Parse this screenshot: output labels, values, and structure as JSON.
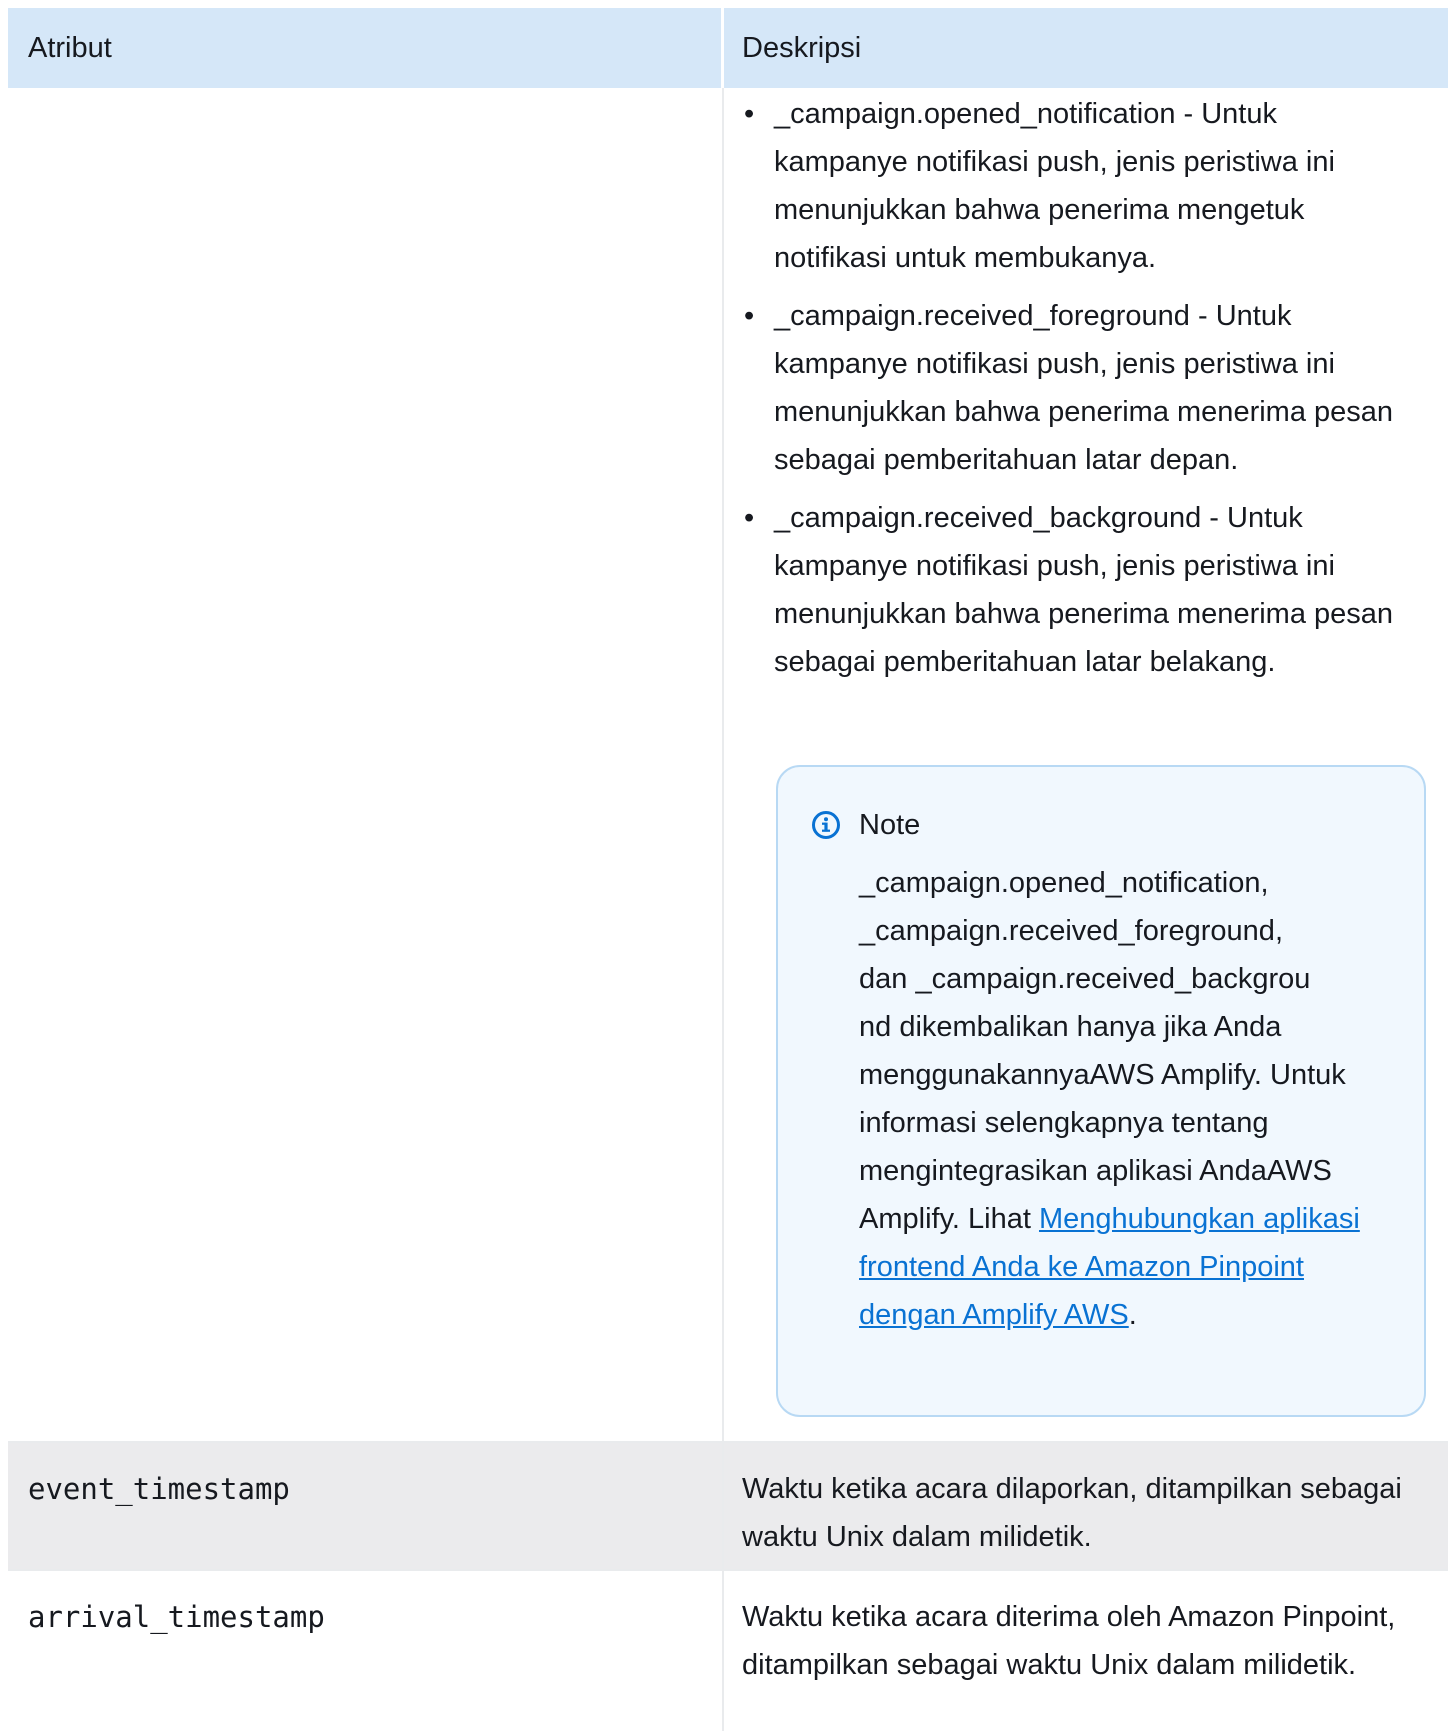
{
  "table": {
    "header": {
      "col_attribute": "Atribut",
      "col_description": "Deskripsi"
    },
    "event_type_bullets": [
      {
        "marker": "•",
        "text": "_campaign.opened_notification - Untuk kampanye notifikasi push, jenis peristiwa ini menunjukkan bahwa penerima mengetuk notifikasi untuk membukanya."
      },
      {
        "marker": "•",
        "text": "_campaign.received_foreground - Untuk kampanye notifikasi push, jenis peristiwa ini menunjukkan bahwa penerima menerima pesan sebagai pemberitahuan latar depan."
      },
      {
        "marker": "•",
        "text": "_campaign.received_background - Untuk kampanye notifikasi push, jenis peristiwa ini menunjukkan bahwa penerima menerima pesan sebagai pemberitahuan latar belakang."
      }
    ],
    "note": {
      "icon": "info-icon",
      "title": "Note",
      "line1": "_campaign.opened_notification,",
      "line2": "_campaign.received_foreground,",
      "line3": "dan _campaign.received_backgrou",
      "line4": "nd dikembalikan hanya jika Anda menggunakannyaAWS Amplify. Untuk informasi selengkapnya tentang mengintegrasikan aplikasi AndaAWS Amplify. Lihat",
      "link_text": "Menghubungkan aplikasi frontend Anda ke Amazon Pinpoint dengan Amplify AWS",
      "trailing": "."
    },
    "rows": [
      {
        "attribute": "event_timestamp",
        "description": "Waktu ketika acara dilaporkan, ditampilkan sebagai waktu Unix dalam milidetik."
      },
      {
        "attribute": "arrival_timestamp",
        "description": "Waktu ketika acara diterima oleh Amazon Pinpoint, ditampilkan sebagai waktu Unix dalam milidetik."
      }
    ]
  },
  "colors": {
    "header_bg": "#d5e7f8",
    "alt_row_bg": "#ebebed",
    "note_bg": "#f1f8fe",
    "note_border": "#b8d9f4",
    "link": "#0972d3",
    "info_icon": "#0972d3"
  }
}
